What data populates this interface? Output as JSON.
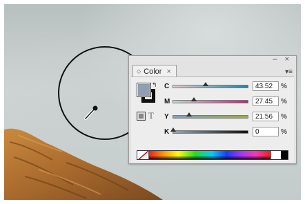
{
  "panel": {
    "tab_label": "Color",
    "close_symbol": "×",
    "window_controls": "– ×",
    "menu_symbol": "▾≡",
    "swap_symbol": "↰",
    "text_mode_symbol": "T",
    "fill_color": "#8f9eb1"
  },
  "channels": [
    {
      "label": "C",
      "value": "43.52",
      "percent": 43.52,
      "unit": "%",
      "gradient": [
        "#e9cccc",
        "#1b86b0"
      ]
    },
    {
      "label": "M",
      "value": "27.45",
      "percent": 27.45,
      "unit": "%",
      "gradient": [
        "#c5d6cf",
        "#b52a7a"
      ]
    },
    {
      "label": "Y",
      "value": "21.56",
      "percent": 21.56,
      "unit": "%",
      "gradient": [
        "#7f9fc4",
        "#9fae3b"
      ]
    },
    {
      "label": "K",
      "value": "0",
      "percent": 0,
      "unit": "%",
      "gradient": [
        "#97a5b8",
        "#111111"
      ]
    }
  ],
  "icons": [
    "eyedropper-icon",
    "swap-colors-icon",
    "panel-menu-icon",
    "none-swatch-icon"
  ]
}
